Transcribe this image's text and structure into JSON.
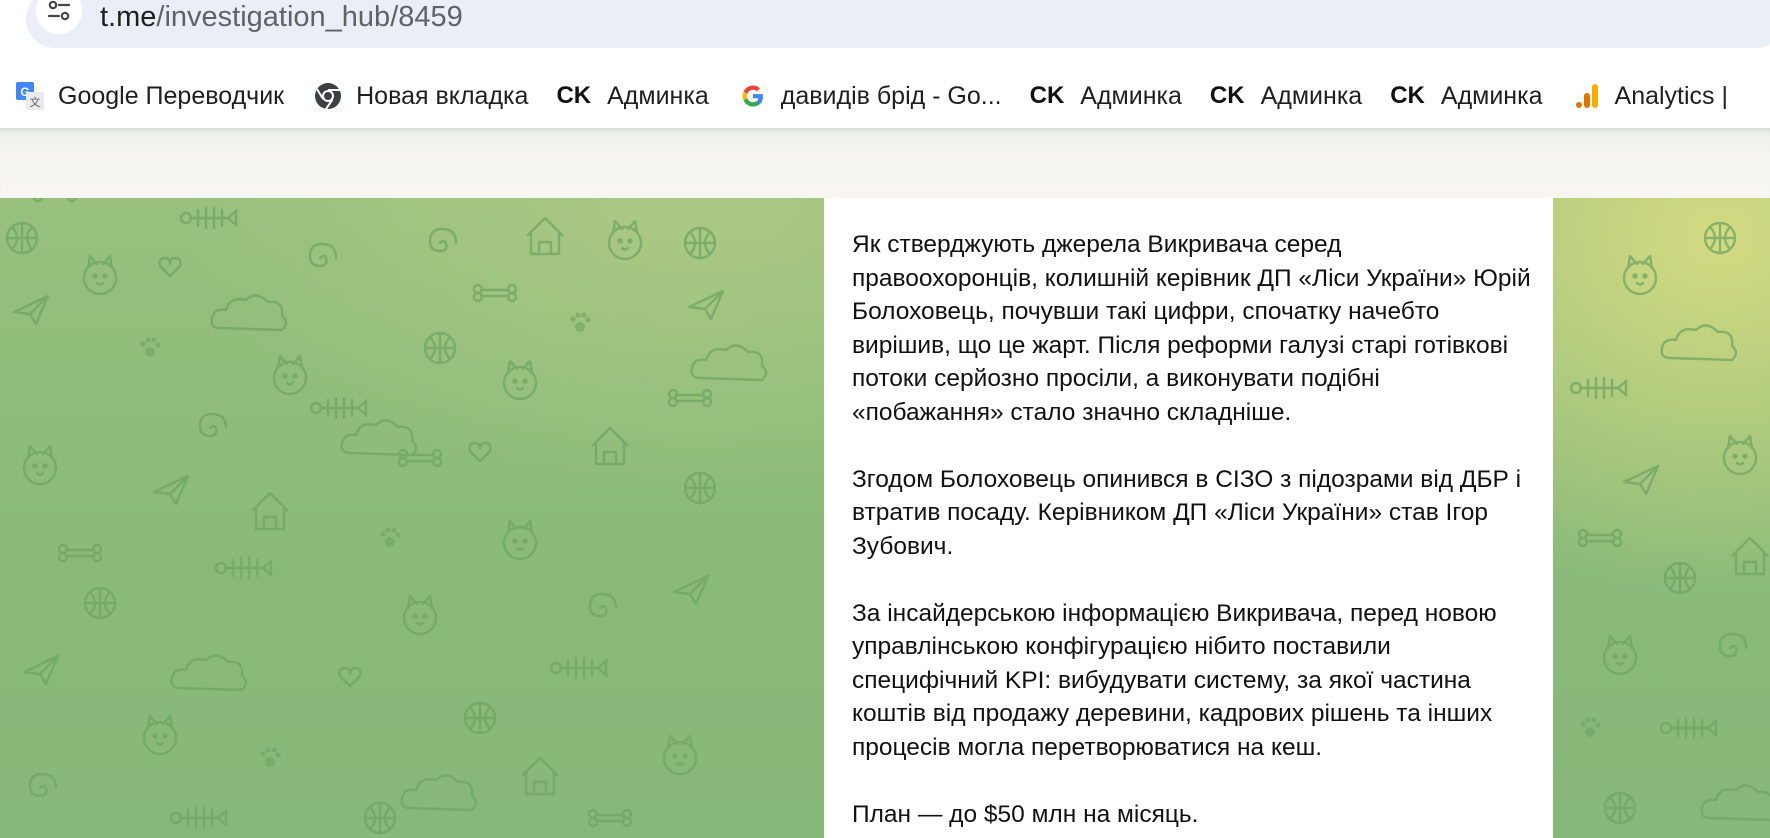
{
  "browser": {
    "url_host": "t.me",
    "url_path": "/investigation_hub/8459",
    "bookmarks": [
      {
        "label": "Google Переводчик",
        "icon": "google-translate-icon"
      },
      {
        "label": "Новая вкладка",
        "icon": "chrome-icon"
      },
      {
        "label": "Админка",
        "icon": "ck-icon",
        "icon_text": "CK"
      },
      {
        "label": "давидів брід - Go...",
        "icon": "google-icon"
      },
      {
        "label": "Админка",
        "icon": "ck-icon",
        "icon_text": "CK"
      },
      {
        "label": "Админка",
        "icon": "ck-icon",
        "icon_text": "CK"
      },
      {
        "label": "Админка",
        "icon": "ck-icon",
        "icon_text": "CK"
      },
      {
        "label": "Analytics |",
        "icon": "analytics-icon"
      }
    ]
  },
  "post": {
    "paragraphs": [
      "Як стверджують джерела Викривача серед правоохоронців, колишній керівник ДП «Ліси України» Юрій Болоховець, почувши такі цифри, спочатку начебто вирішив, що це жарт. Після реформи галузі старі готівкові потоки серйозно просіли, а виконувати подібні «побажання» стало значно складніше.",
      "Згодом Болоховець опинився в СІЗО з підозрами від ДБР і втратив посаду. Керівником ДП «Ліси України» став Ігор Зубович.",
      "За інсайдерською інформацією Викривача, перед новою управлінською конфігурацією нібито поставили специфічний KPI: вибудувати систему, за якої частина коштів від продажу деревини, кадрових рішень та інших процесів могла перетворюватися на кеш.",
      "План — до $50 млн на місяць."
    ]
  },
  "colors": {
    "background_green": "#8bbb7a",
    "background_yellow": "#d7dc82",
    "pattern_stroke": "#6fa463",
    "card": "#ffffff"
  }
}
